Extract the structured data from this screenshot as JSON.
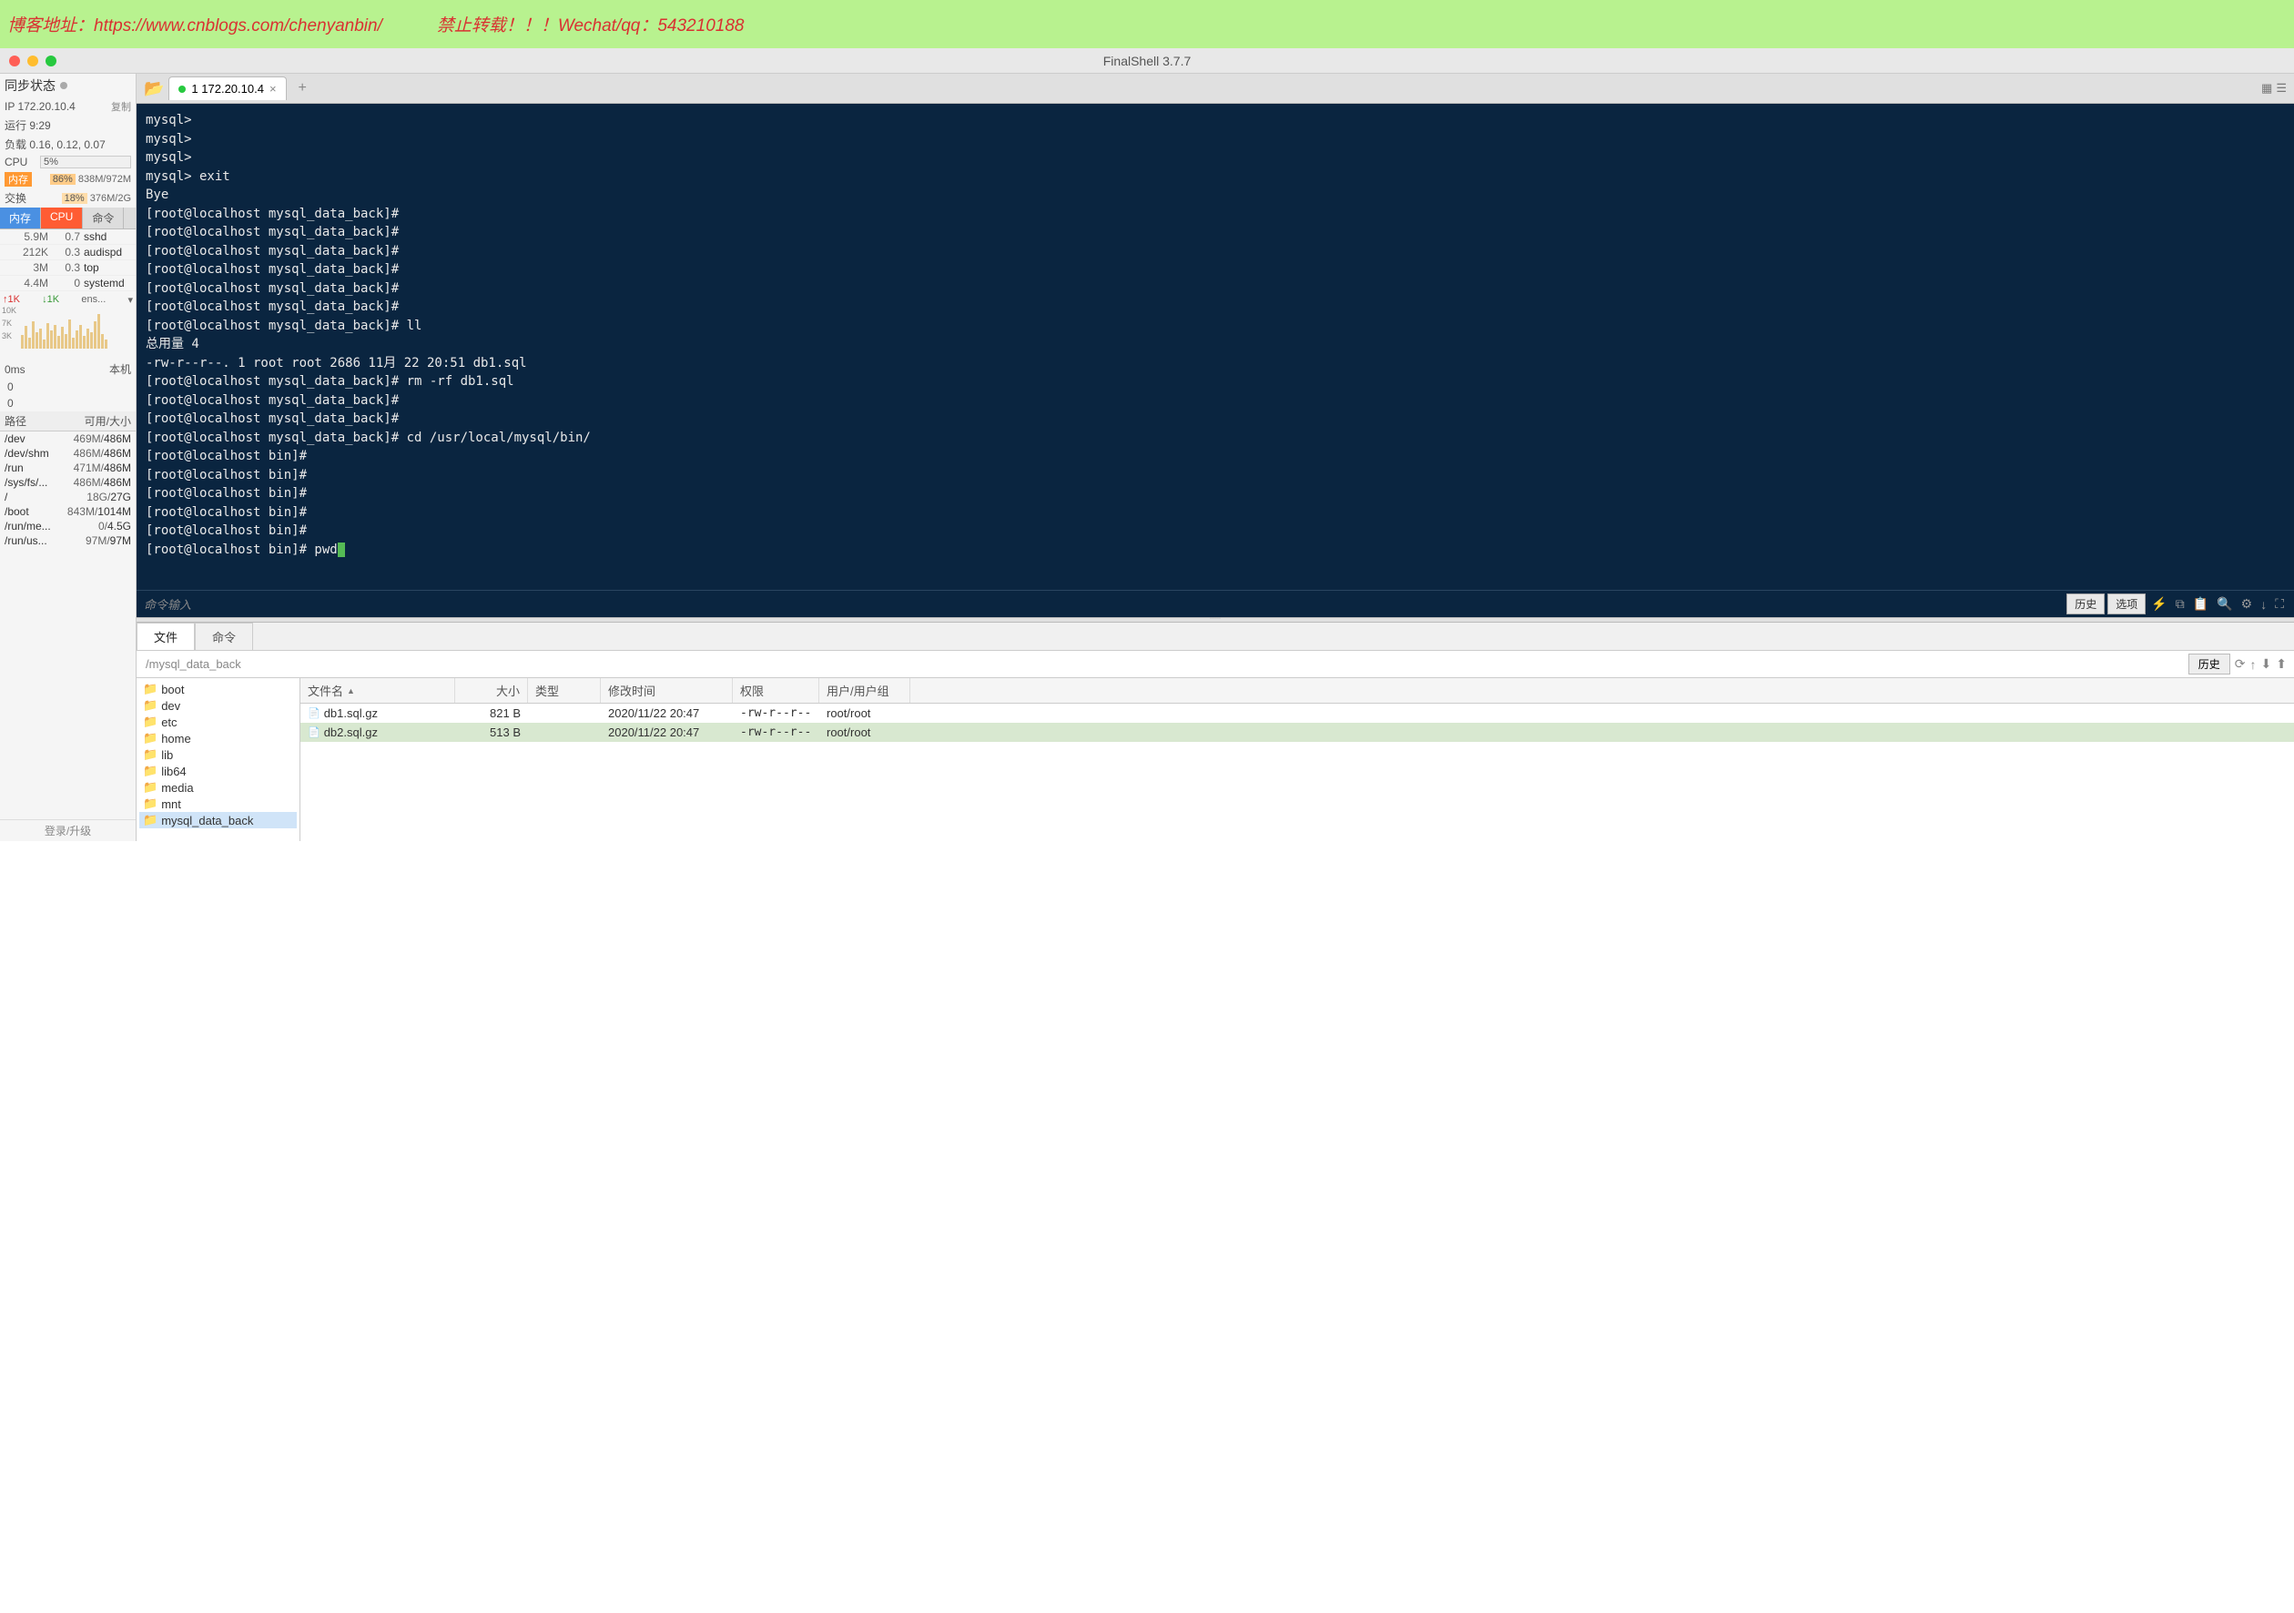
{
  "banner": {
    "blog_label": "博客地址：",
    "blog_url": "https://www.cnblogs.com/chenyanbin/",
    "warning": "禁止转载！！！",
    "contact_label": "Wechat/qq：",
    "contact": "543210188"
  },
  "window": {
    "title": "FinalShell 3.7.7"
  },
  "sidebar": {
    "sync_status_label": "同步状态",
    "ip": "IP 172.20.10.4",
    "copy_label": "复制",
    "uptime": "运行 9:29",
    "load": "负载 0.16, 0.12, 0.07",
    "cpu_label": "CPU",
    "cpu_pct": "5%",
    "mem_label": "内存",
    "mem_pct": "86%",
    "mem_val": "838M/972M",
    "swap_label": "交换",
    "swap_pct": "18%",
    "swap_val": "376M/2G",
    "tabs": {
      "mem": "内存",
      "cpu": "CPU",
      "cmd": "命令"
    },
    "processes": [
      {
        "mem": "5.9M",
        "cpu": "0.7",
        "name": "sshd"
      },
      {
        "mem": "212K",
        "cpu": "0.3",
        "name": "audispd"
      },
      {
        "mem": "3M",
        "cpu": "0.3",
        "name": "top"
      },
      {
        "mem": "4.4M",
        "cpu": "0",
        "name": "systemd"
      }
    ],
    "net": {
      "up": "↑1K",
      "down": "↓1K",
      "iface": "ens...",
      "y0": "10K",
      "y1": "7K",
      "y2": "3K"
    },
    "latency": {
      "label": "0ms",
      "host_label": "本机",
      "v1": "0",
      "v2": "0"
    },
    "disk_header": {
      "path": "路径",
      "size": "可用/大小"
    },
    "disks": [
      {
        "path": "/dev",
        "avail": "469M",
        "total": "486M"
      },
      {
        "path": "/dev/shm",
        "avail": "486M",
        "total": "486M"
      },
      {
        "path": "/run",
        "avail": "471M",
        "total": "486M"
      },
      {
        "path": "/sys/fs/...",
        "avail": "486M",
        "total": "486M"
      },
      {
        "path": "/",
        "avail": "18G",
        "total": "27G"
      },
      {
        "path": "/boot",
        "avail": "843M",
        "total": "1014M"
      },
      {
        "path": "/run/me...",
        "avail": "0",
        "total": "4.5G"
      },
      {
        "path": "/run/us...",
        "avail": "97M",
        "total": "97M"
      }
    ],
    "footer": "登录/升级"
  },
  "tabbar": {
    "tab_label": "1 172.20.10.4"
  },
  "terminal": {
    "lines": [
      "mysql>",
      "mysql>",
      "mysql>",
      "mysql> exit",
      "Bye",
      "[root@localhost mysql_data_back]#",
      "[root@localhost mysql_data_back]#",
      "[root@localhost mysql_data_back]#",
      "[root@localhost mysql_data_back]#",
      "[root@localhost mysql_data_back]#",
      "[root@localhost mysql_data_back]#",
      "[root@localhost mysql_data_back]# ll",
      "总用量 4",
      "-rw-r--r--. 1 root root 2686 11月 22 20:51 db1.sql",
      "[root@localhost mysql_data_back]# rm -rf db1.sql",
      "[root@localhost mysql_data_back]#",
      "[root@localhost mysql_data_back]#",
      "[root@localhost mysql_data_back]# cd /usr/local/mysql/bin/",
      "[root@localhost bin]#",
      "[root@localhost bin]#",
      "[root@localhost bin]#",
      "[root@localhost bin]#",
      "[root@localhost bin]#",
      "[root@localhost bin]# pwd"
    ],
    "cmd_placeholder": "命令输入",
    "history_btn": "历史",
    "options_btn": "选项"
  },
  "file_panel": {
    "tabs": {
      "file": "文件",
      "cmd": "命令"
    },
    "path": "/mysql_data_back",
    "history_btn": "历史",
    "tree": [
      "boot",
      "dev",
      "etc",
      "home",
      "lib",
      "lib64",
      "media",
      "mnt",
      "mysql_data_back"
    ],
    "columns": {
      "name": "文件名",
      "size": "大小",
      "type": "类型",
      "date": "修改时间",
      "perm": "权限",
      "user": "用户/用户组"
    },
    "files": [
      {
        "name": "db1.sql.gz",
        "size": "821 B",
        "type": "",
        "date": "2020/11/22 20:47",
        "perm": "-rw-r--r--",
        "user": "root/root"
      },
      {
        "name": "db2.sql.gz",
        "size": "513 B",
        "type": "",
        "date": "2020/11/22 20:47",
        "perm": "-rw-r--r--",
        "user": "root/root"
      }
    ]
  }
}
